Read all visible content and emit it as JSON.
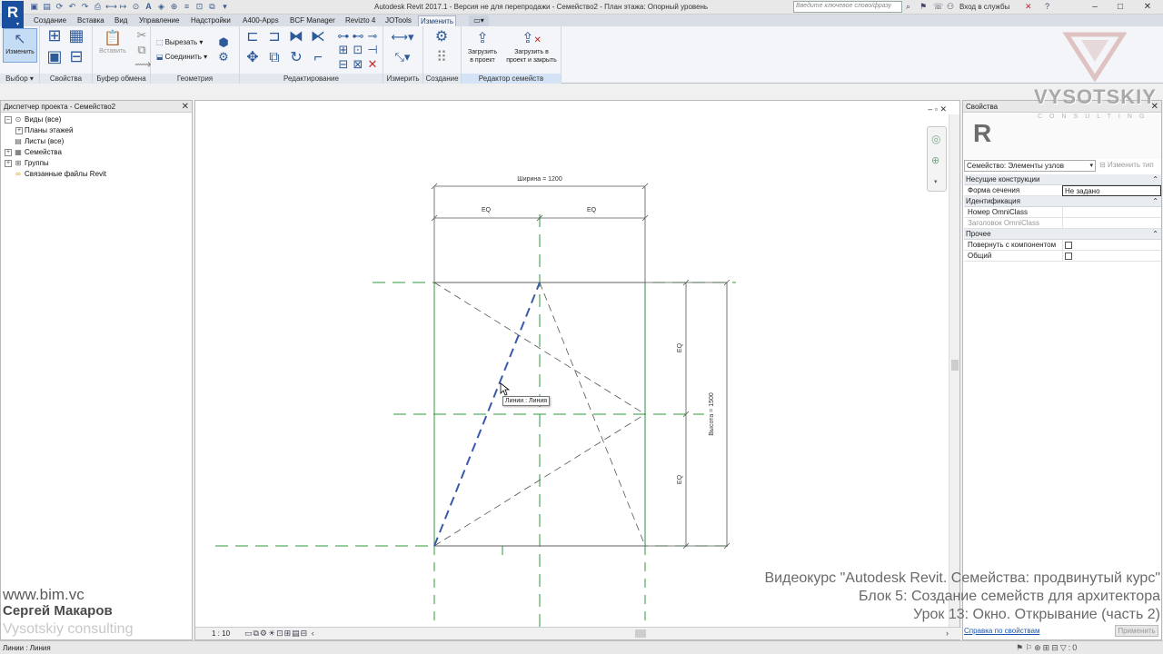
{
  "app": {
    "title": "Autodesk Revit 2017.1 -  Версия не для перепродажи -    Семейство2 - План этажа: Опорный уровень",
    "logo_letter": "R",
    "search_placeholder": "Введите ключевое слово/фразу",
    "signin": "Вход в службы"
  },
  "tabs": [
    {
      "label": "Создание"
    },
    {
      "label": "Вставка"
    },
    {
      "label": "Вид"
    },
    {
      "label": "Управление"
    },
    {
      "label": "Надстройки"
    },
    {
      "label": "A400-Apps"
    },
    {
      "label": "BCF Manager"
    },
    {
      "label": "Revizto 4"
    },
    {
      "label": "JOTools"
    },
    {
      "label": "Изменить"
    }
  ],
  "ribbon": {
    "modify_label": "Изменить",
    "paste_label": "Вставить",
    "cut_label": "Вырезать",
    "join_label": "Соединить",
    "load_project_label": "Загрузить\nв проект",
    "load_close_label": "Загрузить в\nпроект и закрыть",
    "panels": {
      "select": "Выбор",
      "properties": "Свойства",
      "clipboard": "Буфер обмена",
      "geometry": "Геометрия",
      "modify": "Редактирование",
      "measure": "Измерить",
      "create": "Создание",
      "family_editor": "Редактор семейств"
    }
  },
  "browser": {
    "title": "Диспетчер проекта - Семейство2",
    "items": [
      {
        "label": "Виды (все)"
      },
      {
        "label": "Планы этажей"
      },
      {
        "label": "Листы (все)"
      },
      {
        "label": "Семейства"
      },
      {
        "label": "Группы"
      },
      {
        "label": "Связанные файлы Revit"
      }
    ]
  },
  "canvas": {
    "width_dim": "Ширина = 1200",
    "eq_top_left": "EQ",
    "eq_top_right": "EQ",
    "eq_right_top": "EQ",
    "eq_right_bottom": "EQ",
    "height_dim": "Высота = 1500",
    "tooltip": "Линии : Линия",
    "scale": "1 : 10"
  },
  "properties": {
    "title": "Свойства",
    "type_letter": "R",
    "family_selector": "Семейство: Элементы узлов",
    "edit_type": "Изменить тип",
    "groups": [
      {
        "label": "Несущие конструкции",
        "rows": [
          {
            "name": "Форма сечения",
            "value": "Не задано"
          }
        ]
      },
      {
        "label": "Идентификация",
        "rows": [
          {
            "name": "Номер OmniClass",
            "value": ""
          },
          {
            "name": "Заголовок OmniClass",
            "value": ""
          }
        ]
      },
      {
        "label": "Прочее",
        "rows": [
          {
            "name": "Повернуть с компонентом",
            "value": ""
          },
          {
            "name": "Общий",
            "value": ""
          }
        ]
      }
    ],
    "help_link": "Справка по свойствам",
    "apply": "Применить"
  },
  "status": {
    "text": "Линии : Линия",
    "zero": ":0"
  },
  "overlay": {
    "site": "www.bim.vc",
    "author": "Сергей Макаров",
    "company": "Vysotskiy consulting",
    "course_line1": "Видеокурс \"Autodesk Revit. Семейства: продвинутый курс\"",
    "course_line2": "Блок 5: Создание семейств для архитектора",
    "course_line3": "Урок 13: Окно. Открывание (часть 2)",
    "brand_name": "VYSOTSKIY",
    "brand_sub": "CONSULTING"
  },
  "colors": {
    "ref_plane": "#2e9a3a",
    "selected_line": "#3a5aa8",
    "accent": "#1a4fa0"
  }
}
